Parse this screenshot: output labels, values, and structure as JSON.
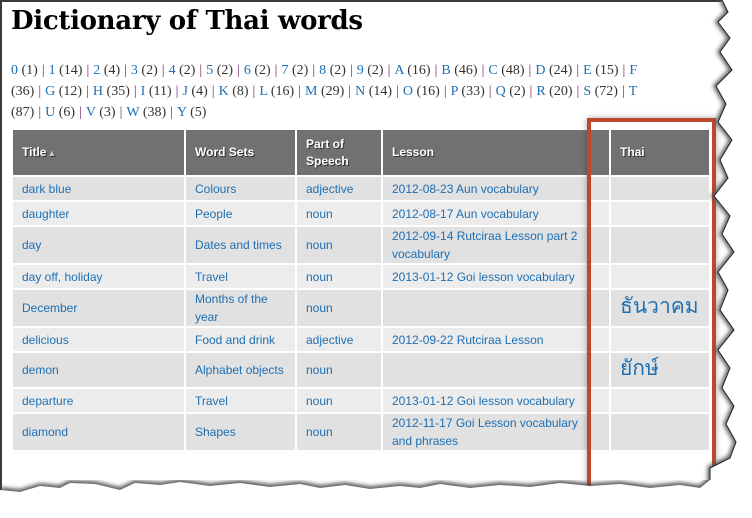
{
  "page": {
    "title": "Dictionary of Thai words"
  },
  "index": [
    {
      "letter": "0",
      "count": "(1)"
    },
    {
      "letter": "1",
      "count": "(14)"
    },
    {
      "letter": "2",
      "count": "(4)"
    },
    {
      "letter": "3",
      "count": "(2)"
    },
    {
      "letter": "4",
      "count": "(2)"
    },
    {
      "letter": "5",
      "count": "(2)"
    },
    {
      "letter": "6",
      "count": "(2)"
    },
    {
      "letter": "7",
      "count": "(2)"
    },
    {
      "letter": "8",
      "count": "(2)"
    },
    {
      "letter": "9",
      "count": "(2)"
    },
    {
      "letter": "A",
      "count": "(16)"
    },
    {
      "letter": "B",
      "count": "(46)"
    },
    {
      "letter": "C",
      "count": "(48)"
    },
    {
      "letter": "D",
      "count": "(24)"
    },
    {
      "letter": "E",
      "count": "(15)"
    },
    {
      "letter": "F",
      "count": "(36)"
    },
    {
      "letter": "G",
      "count": "(12)"
    },
    {
      "letter": "H",
      "count": "(35)"
    },
    {
      "letter": "I",
      "count": "(11)"
    },
    {
      "letter": "J",
      "count": "(4)"
    },
    {
      "letter": "K",
      "count": "(8)"
    },
    {
      "letter": "L",
      "count": "(16)"
    },
    {
      "letter": "M",
      "count": "(29)"
    },
    {
      "letter": "N",
      "count": "(14)"
    },
    {
      "letter": "O",
      "count": "(16)"
    },
    {
      "letter": "P",
      "count": "(33)"
    },
    {
      "letter": "Q",
      "count": "(2)"
    },
    {
      "letter": "R",
      "count": "(20)"
    },
    {
      "letter": "S",
      "count": "(72)"
    },
    {
      "letter": "T",
      "count": "(87)"
    },
    {
      "letter": "U",
      "count": "(6)"
    },
    {
      "letter": "V",
      "count": "(3)"
    },
    {
      "letter": "W",
      "count": "(38)"
    },
    {
      "letter": "Y",
      "count": "(5)"
    }
  ],
  "table": {
    "headers": {
      "title": "Title",
      "title_sort_icon": "sort-ascending-icon",
      "word_sets": "Word Sets",
      "part_of_speech": "Part of Speech",
      "lesson": "Lesson",
      "thai": "Thai"
    },
    "rows": [
      {
        "title": "dark blue",
        "word_set": "Colours",
        "pos": "adjective",
        "lesson": "2012-08-23 Aun vocabulary",
        "thai": ""
      },
      {
        "title": "daughter",
        "word_set": "People",
        "pos": "noun",
        "lesson": "2012-08-17 Aun vocabulary",
        "thai": ""
      },
      {
        "title": "day",
        "word_set": "Dates and times",
        "pos": "noun",
        "lesson": "2012-09-14 Rutciraa Lesson part 2 vocabulary",
        "thai": ""
      },
      {
        "title": "day off, holiday",
        "word_set": "Travel",
        "pos": "noun",
        "lesson": "2013-01-12 Goi lesson vocabulary",
        "thai": ""
      },
      {
        "title": "December",
        "word_set": "Months of the year",
        "pos": "noun",
        "lesson": "",
        "thai": "ธันวาคม"
      },
      {
        "title": "delicious",
        "word_set": "Food and drink",
        "pos": "adjective",
        "lesson": "2012-09-22 Rutciraa Lesson",
        "thai": ""
      },
      {
        "title": "demon",
        "word_set": "Alphabet objects",
        "pos": "noun",
        "lesson": "",
        "thai": "ยักษ์"
      },
      {
        "title": "departure",
        "word_set": "Travel",
        "pos": "noun",
        "lesson": "2013-01-12 Goi lesson vocabulary",
        "thai": ""
      },
      {
        "title": "diamond",
        "word_set": "Shapes",
        "pos": "noun",
        "lesson": "2012-11-17 Goi Lesson vocabulary and phrases",
        "thai": ""
      }
    ]
  },
  "colors": {
    "link": "#1e6fb3",
    "header_bg": "#717171",
    "row_odd": "#e1e1e1",
    "row_even": "#ececec",
    "highlight_border": "#c0472f"
  }
}
